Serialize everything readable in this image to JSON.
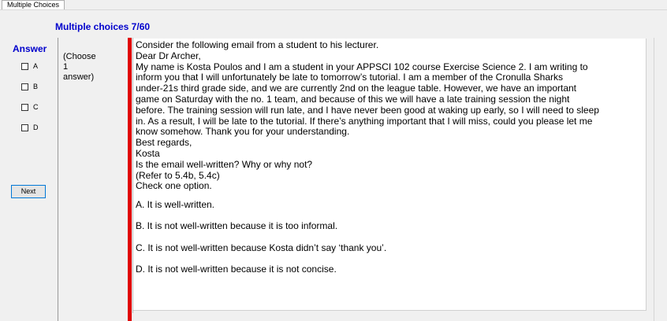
{
  "tab": {
    "label": "Multiple Choices"
  },
  "header": {
    "title": "Multiple choices 7/60"
  },
  "answer_panel": {
    "label": "Answer",
    "options": [
      "A",
      "B",
      "C",
      "D"
    ],
    "next_label": "Next"
  },
  "instruction": "(Choose\n1\nanswer)",
  "question": {
    "lines": [
      "Consider the following email from a student to his lecturer.",
      "Dear Dr Archer,",
      "My name is Kosta Poulos and I am a student in your APPSCI 102 course Exercise Science 2. I am writing to",
      "inform you that I will unfortunately be late to tomorrow’s tutorial. I am a member of the Cronulla Sharks",
      "under-21s third grade side, and we are currently 2nd on the league table. However, we have an important",
      "game on Saturday with the no. 1 team, and because of this we will have a late training session the night",
      "before. The training session will run late, and I have never been good at waking up early, so I will need to sleep",
      "in. As a result, I will be late to the tutorial. If there’s anything important that I will miss, could you please let me",
      "know somehow. Thank you for your understanding.",
      "Best regards,",
      "Kosta",
      "Is the email well-written? Why or why not?",
      "(Refer to 5.4b, 5.4c)",
      "Check one option."
    ],
    "choices": [
      "A.  It is well-written.",
      "B.  It is not well-written because it is too informal.",
      "C.  It is not well-written because Kosta didn’t say ‘thank you’.",
      "D.  It is not well-written because it is not concise."
    ]
  }
}
